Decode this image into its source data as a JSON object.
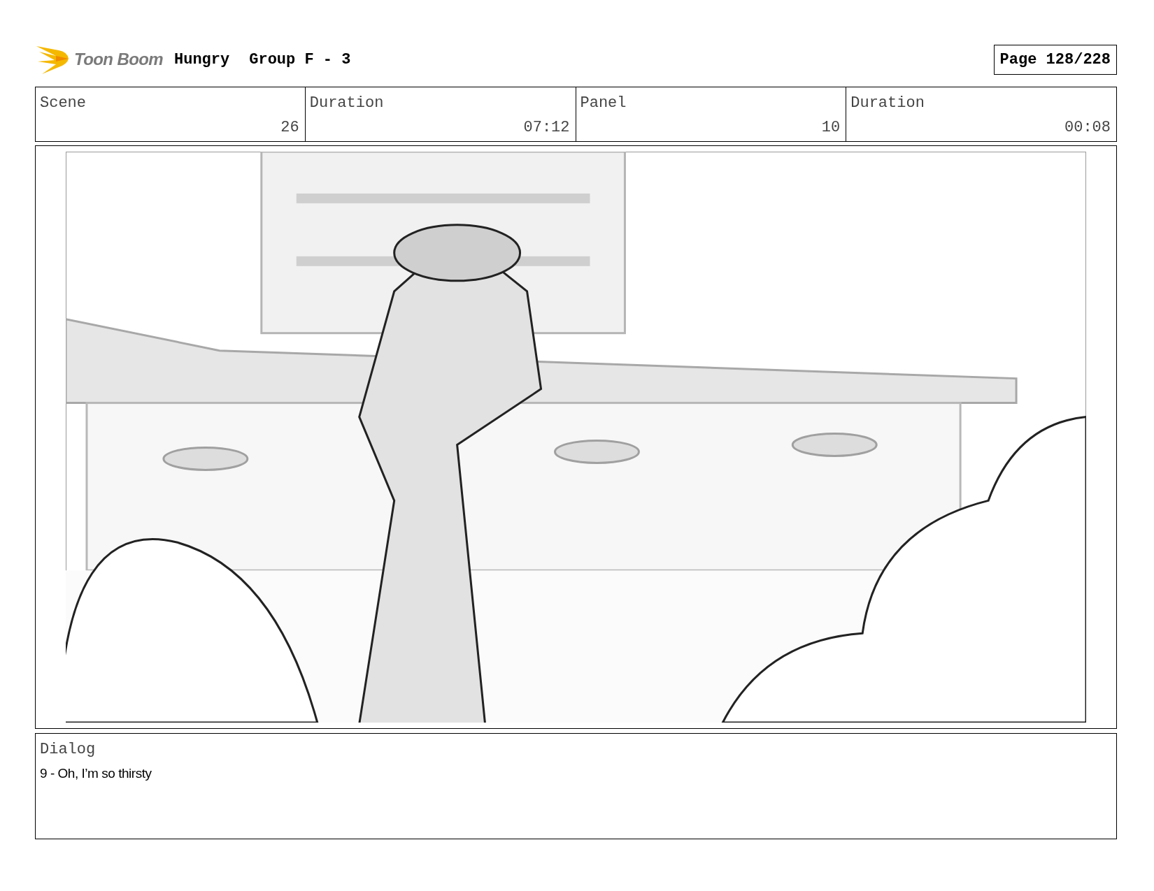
{
  "header": {
    "logo_text": "Toon Boom",
    "project": "Hungry",
    "group": "Group F - 3",
    "page": "Page 128/228"
  },
  "info_labels": [
    "Scene",
    "Duration",
    "Panel",
    "Duration"
  ],
  "info_values": [
    "26",
    "07:12",
    "10",
    "00:08"
  ],
  "dialog": {
    "label": "Dialog",
    "text": "9 - Oh, I’m so thirsty"
  }
}
